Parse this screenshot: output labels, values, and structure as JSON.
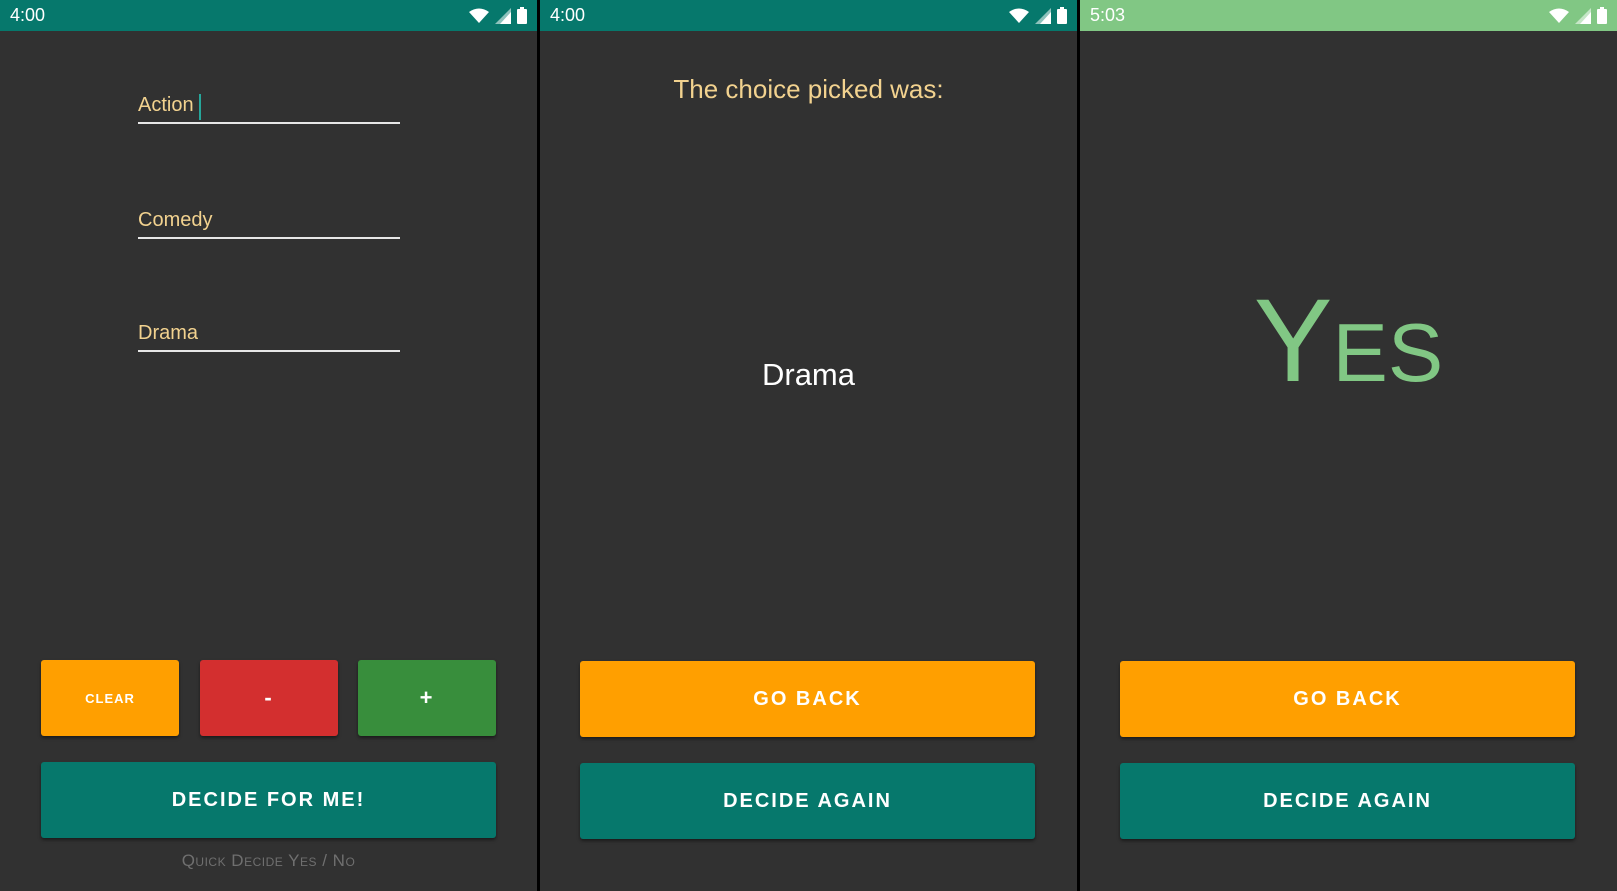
{
  "screens": {
    "input": {
      "status_time": "4:00",
      "fields": [
        {
          "value": "Action"
        },
        {
          "value": "Comedy"
        },
        {
          "value": "Drama"
        }
      ],
      "buttons": {
        "clear": "CLEAR",
        "minus": "-",
        "plus": "+",
        "decide": "DECIDE FOR ME!"
      },
      "quick_link": "Quick Decide Yes / No"
    },
    "result": {
      "status_time": "4:00",
      "heading": "The choice picked was:",
      "choice": "Drama",
      "buttons": {
        "go_back": "GO BACK",
        "decide_again": "DECIDE AGAIN"
      }
    },
    "yes_no": {
      "status_time": "5:03",
      "answer": "Yes",
      "buttons": {
        "go_back": "GO BACK",
        "decide_again": "DECIDE AGAIN"
      }
    }
  },
  "colors": {
    "status_bar": "#06786c",
    "status_bar_yes_no": "#81c784",
    "background": "#313131",
    "field_text": "#f2d28f",
    "orange": "#ff9f00",
    "red": "#d32f2f",
    "green": "#388e3c",
    "teal": "#06786c",
    "yes_text": "#81c784"
  },
  "icons": [
    "wifi-icon",
    "signal-icon",
    "battery-icon"
  ]
}
